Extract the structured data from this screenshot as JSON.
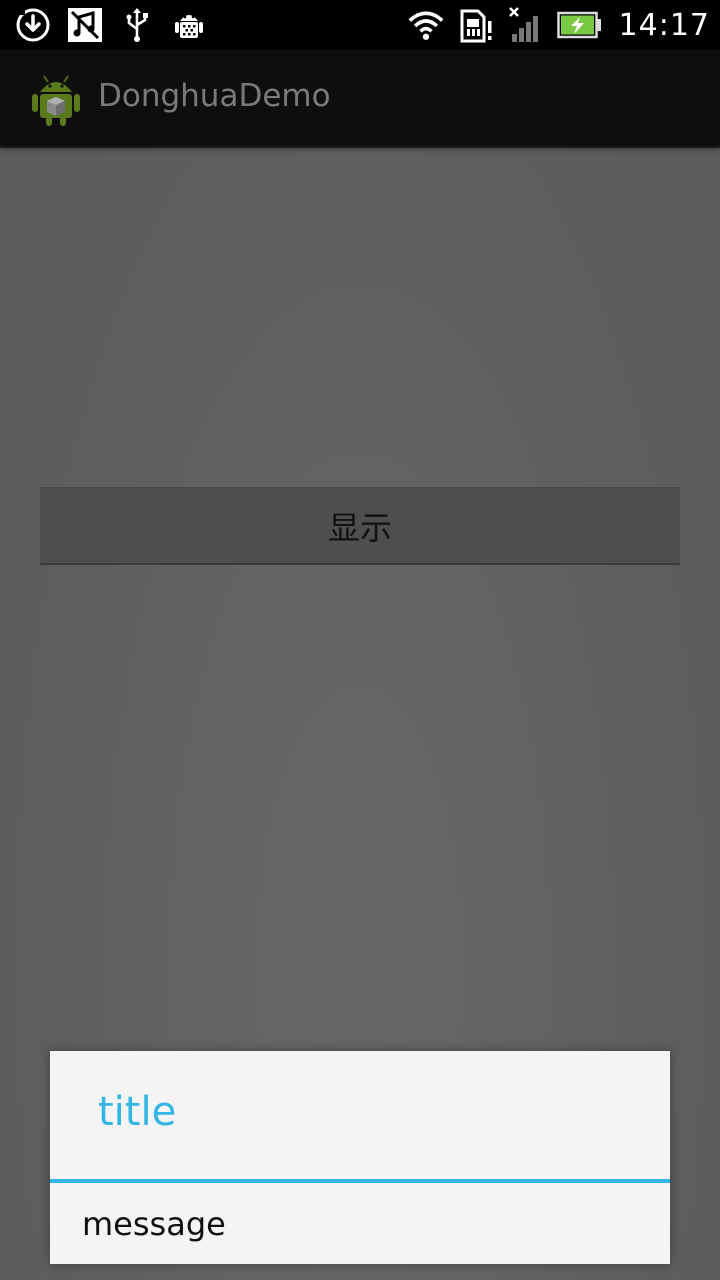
{
  "status_bar": {
    "time": "14:17",
    "left_icons": [
      "download-icon",
      "music-off-icon",
      "usb-icon",
      "android-debug-icon"
    ],
    "right_icons": [
      "wifi-icon",
      "sim-card-alert-icon",
      "signal-no-service-icon",
      "battery-charging-icon"
    ]
  },
  "action_bar": {
    "app_icon": "android-app-icon",
    "title": "DonghuaDemo"
  },
  "main": {
    "button_label": "显示"
  },
  "dialog": {
    "title": "title",
    "message": "message"
  },
  "colors": {
    "accent": "#33b5e5",
    "background": "#5f5f5f",
    "action_bar": "#0e0e0e"
  }
}
